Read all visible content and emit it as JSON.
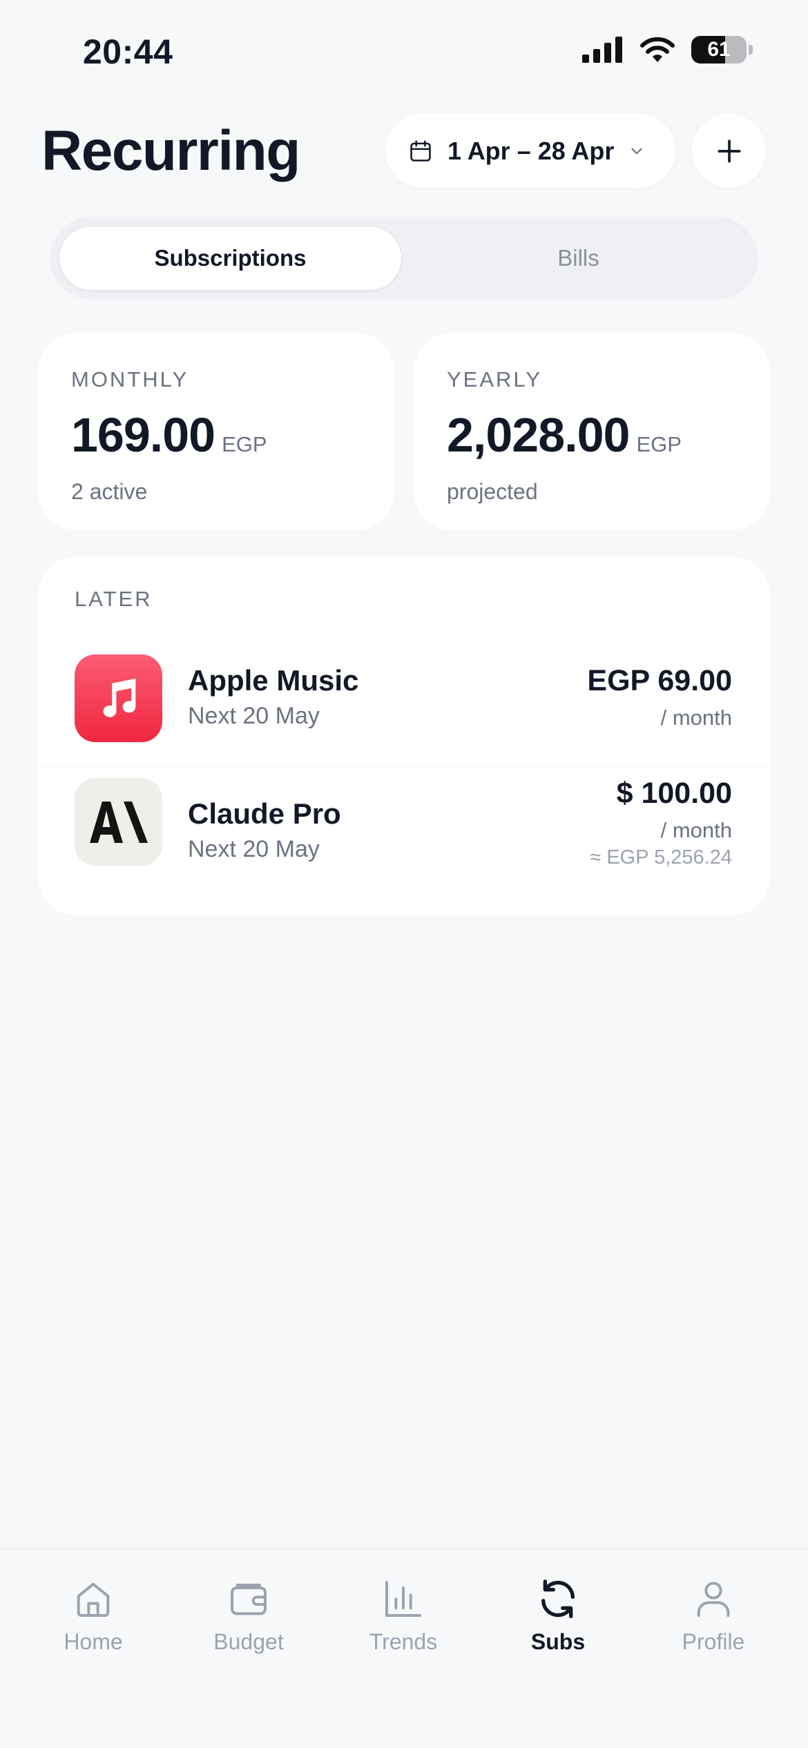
{
  "status": {
    "time": "20:44",
    "battery": "61",
    "battery_level": 0.61
  },
  "header": {
    "title": "Recurring",
    "date_range": "1 Apr – 28 Apr"
  },
  "tabs": {
    "active": "Subscriptions",
    "inactive": "Bills"
  },
  "summary": {
    "monthly": {
      "label": "MONTHLY",
      "amount": "169.00",
      "unit": "EGP",
      "sub": "2 active"
    },
    "yearly": {
      "label": "YEARLY",
      "amount": "2,028.00",
      "unit": "EGP",
      "sub": "projected"
    }
  },
  "list": {
    "section": "LATER",
    "items": [
      {
        "name": "Apple Music",
        "next": "Next 20 May",
        "price": "EGP 69.00",
        "period": "/ month",
        "icon": "music-note-icon"
      },
      {
        "name": "Claude Pro",
        "next": "Next 20 May",
        "price": "$ 100.00",
        "period": "/ month",
        "converted": "≈ EGP 5,256.24",
        "icon": "anthropic-logo-icon"
      }
    ]
  },
  "tabbar": {
    "items": [
      {
        "label": "Home",
        "icon": "home-icon"
      },
      {
        "label": "Budget",
        "icon": "wallet-icon"
      },
      {
        "label": "Trends",
        "icon": "bar-chart-icon"
      },
      {
        "label": "Subs",
        "icon": "refresh-icon"
      },
      {
        "label": "Profile",
        "icon": "person-icon"
      }
    ],
    "active": "Subs"
  },
  "colors": {
    "background": "#f7f8fa",
    "text": "#121826",
    "muted": "#6b7280",
    "apple_music_red": "#f0273f"
  }
}
